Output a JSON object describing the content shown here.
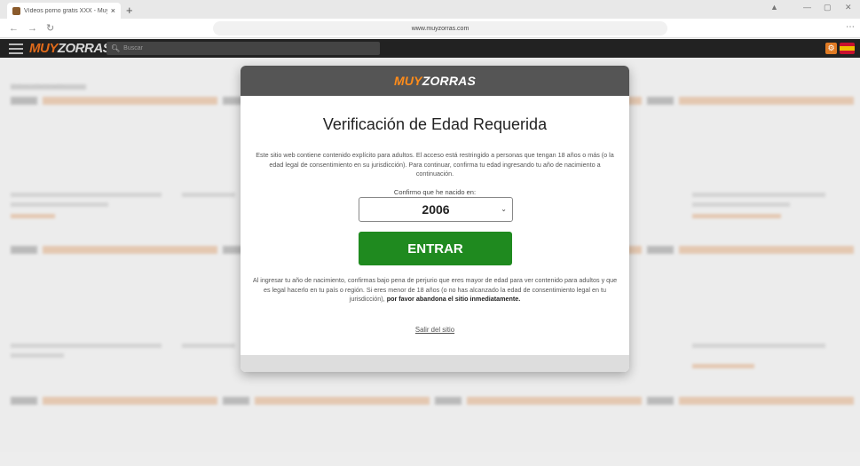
{
  "browser": {
    "tab_title": "Vídeos porno gratis XXX - MuyZorras",
    "tab_close": "×",
    "new_tab": "+",
    "url": "www.muyzorras.com"
  },
  "site": {
    "logo_part1": "MUY",
    "logo_part2": "ZORRAS",
    "search_placeholder": "Buscar",
    "bg_section_title": "Videos relacionados"
  },
  "modal": {
    "logo_part1": "MUY",
    "logo_part2": "ZORRAS",
    "title": "Verificación de Edad Requerida",
    "description": "Este sitio web contiene contenido explícito para adultos. El acceso está restringido a personas que tengan 18 años o más (o la edad legal de consentimiento en su jurisdicción). Para continuar, confirma tu edad ingresando tu año de nacimiento a continuación.",
    "confirm_label": "Confirmo que he nacido en:",
    "selected_year": "2006",
    "enter_label": "ENTRAR",
    "legal_text": "Al ingresar tu año de nacimiento, confirmas bajo pena de perjurio que eres mayor de edad para ver contenido para adultos y que es legal hacerlo en tu país o región. Si eres menor de 18 años (o no has alcanzado la edad de consentimiento legal en tu jurisdicción),",
    "legal_bold": "por favor abandona el sitio inmediatamente.",
    "exit_label": "Salir del sitio"
  },
  "colors": {
    "accent": "#e06a1a",
    "enter_button": "#1f8a1f",
    "header_bg": "#222222",
    "modal_head": "#555555"
  }
}
